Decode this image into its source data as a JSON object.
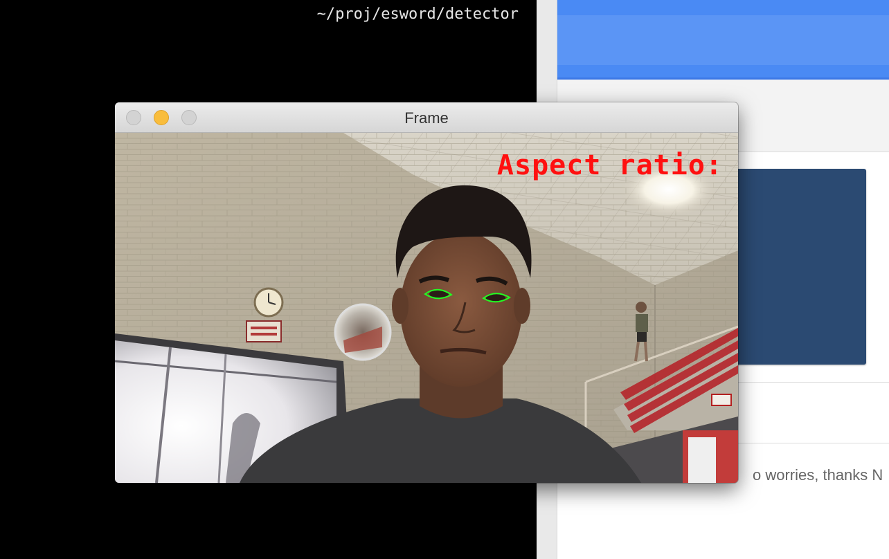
{
  "terminal": {
    "path": "~/proj/esword/detector"
  },
  "browser": {
    "message_text": "o worries, thanks N"
  },
  "window": {
    "title": "Frame"
  },
  "video": {
    "overlay_text": "Aspect ratio:"
  },
  "colors": {
    "overlay_text": "#ff1010",
    "eye_contour": "#22ff22",
    "minimize_button": "#f9bd3c",
    "browser_header": "#4a8af4",
    "navy_card": "#2b4a72"
  }
}
